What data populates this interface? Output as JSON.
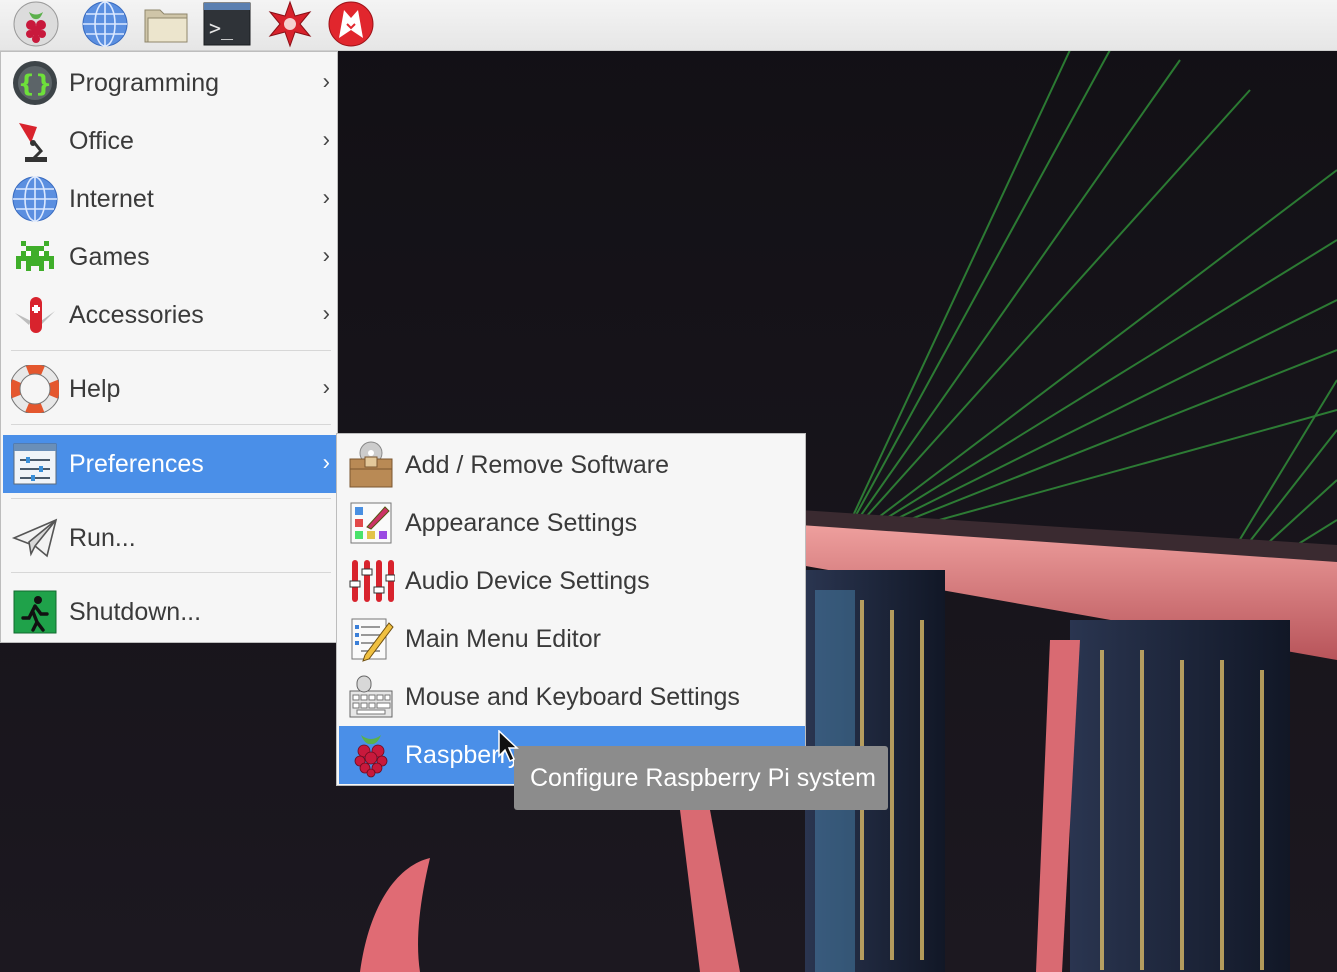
{
  "panel": {
    "launchers": [
      {
        "name": "raspberry-menu-icon"
      },
      {
        "name": "web-browser-icon"
      },
      {
        "name": "file-manager-icon"
      },
      {
        "name": "terminal-icon"
      },
      {
        "name": "mathematica-icon"
      },
      {
        "name": "wolfram-icon"
      }
    ],
    "terminal_glyph": ">_"
  },
  "main_menu": {
    "items": [
      {
        "label": "Programming",
        "icon": "programming-icon",
        "submenu": true
      },
      {
        "label": "Office",
        "icon": "office-lamp-icon",
        "submenu": true
      },
      {
        "label": "Internet",
        "icon": "globe-icon",
        "submenu": true
      },
      {
        "label": "Games",
        "icon": "space-invader-icon",
        "submenu": true
      },
      {
        "label": "Accessories",
        "icon": "pocket-knife-icon",
        "submenu": true
      },
      {
        "label": "Help",
        "icon": "lifebuoy-icon",
        "submenu": true
      },
      {
        "label": "Preferences",
        "icon": "preferences-icon",
        "submenu": true,
        "selected": true
      },
      {
        "label": "Run...",
        "icon": "paper-plane-icon"
      },
      {
        "label": "Shutdown...",
        "icon": "exit-icon"
      }
    ],
    "chevron": "›"
  },
  "preferences_menu": {
    "items": [
      {
        "label": "Add / Remove Software",
        "icon": "package-icon"
      },
      {
        "label": "Appearance Settings",
        "icon": "palette-icon"
      },
      {
        "label": "Audio Device Settings",
        "icon": "mixer-icon"
      },
      {
        "label": "Main Menu Editor",
        "icon": "menu-editor-icon"
      },
      {
        "label": "Mouse and Keyboard Settings",
        "icon": "keyboard-mouse-icon"
      },
      {
        "label": "Raspberry",
        "icon": "raspberry-icon",
        "selected": true
      }
    ]
  },
  "tooltip": {
    "text": "Configure Raspberry Pi system"
  },
  "colors": {
    "selection": "#4a8fe8",
    "menu_bg": "#f6f6f6",
    "tooltip_bg": "#8c8c8c",
    "desktop_bg": "#141218"
  }
}
